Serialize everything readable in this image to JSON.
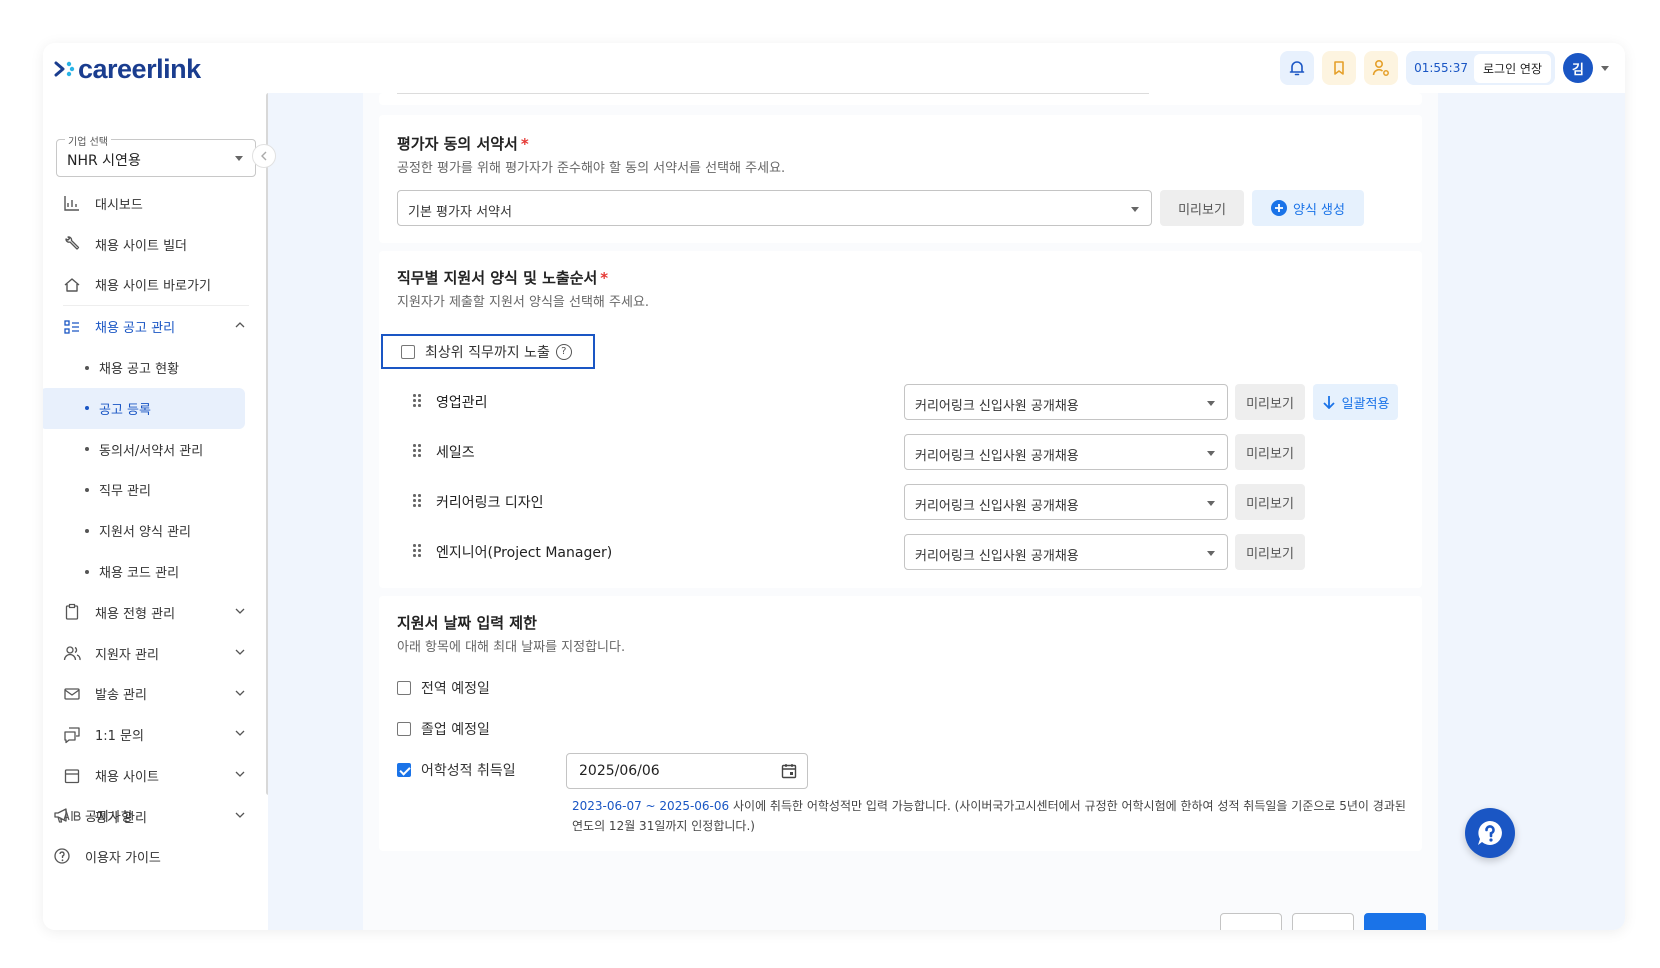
{
  "brand": {
    "logo_text": "careerlink",
    "primary_color": "#1a56c4"
  },
  "header": {
    "session_time": "01:55:37",
    "extend_label": "로그인 연장",
    "avatar_initial": "김"
  },
  "sidebar": {
    "company_label": "기업 선택",
    "company_value": "NHR 시연용",
    "items": [
      {
        "label": "대시보드",
        "icon": "chart-icon"
      },
      {
        "label": "채용 사이트 빌더",
        "icon": "wrench-icon"
      },
      {
        "label": "채용 사이트 바로가기",
        "icon": "home-icon"
      },
      {
        "label": "채용 공고 관리",
        "icon": "list-icon"
      },
      {
        "label": "채용 전형 관리",
        "icon": "clipboard-icon"
      },
      {
        "label": "지원자 관리",
        "icon": "users-icon"
      },
      {
        "label": "발송 관리",
        "icon": "mail-icon"
      },
      {
        "label": "1:1 문의",
        "icon": "chat-icon"
      },
      {
        "label": "채용 사이트",
        "icon": "calendar-icon"
      },
      {
        "label": "평가 관리",
        "icon": "ab-icon"
      }
    ],
    "sub_items": [
      "채용 공고 현황",
      "공고 등록",
      "동의서/서약서 관리",
      "직무 관리",
      "지원서 양식 관리",
      "채용 코드 관리"
    ],
    "bottom": [
      {
        "label": "공지사항",
        "icon": "megaphone-icon"
      },
      {
        "label": "이용자 가이드",
        "icon": "help-icon"
      }
    ]
  },
  "pledge": {
    "title": "평가자 동의 서약서",
    "required_mark": "*",
    "desc": "공정한 평가를 위해 평가자가 준수해야 할 동의 서약서를 선택해 주세요.",
    "select_value": "기본 평가자 서약서",
    "preview_label": "미리보기",
    "create_label": "양식 생성"
  },
  "forms": {
    "title": "직무별 지원서 양식 및 노출순서",
    "required_mark": "*",
    "desc": "지원자가 제출할 지원서 양식을 선택해 주세요.",
    "top_check_label": "최상위 직무까지 노출",
    "apply_all_label": "일괄적용",
    "preview_label": "미리보기",
    "jobs": [
      {
        "name": "영업관리",
        "form": "커리어링크 신입사원 공개채용"
      },
      {
        "name": "세일즈",
        "form": "커리어링크 신입사원 공개채용"
      },
      {
        "name": "커리어링크 디자인",
        "form": "커리어링크 신입사원 공개채용"
      },
      {
        "name": "엔지니어(Project Manager)",
        "form": "커리어링크 신입사원 공개채용"
      }
    ]
  },
  "dates": {
    "title": "지원서 날짜 입력 제한",
    "desc": "아래 항목에 대해 최대 날짜를 지정합니다.",
    "options": [
      {
        "label": "전역 예정일",
        "checked": false
      },
      {
        "label": "졸업 예정일",
        "checked": false
      },
      {
        "label": "어학성적 취득일",
        "checked": true
      }
    ],
    "language_date": "2025/06/06",
    "note_range": "2023-06-07 ~ 2025-06-06",
    "note_text": " 사이에 취득한 어학성적만 입력 가능합니다. (사이버국가고시센터에서 규정한 어학시험에 한하여 성적 취득일을 기준으로 5년이 경과된 연도의 12월 31일까지 인정합니다.)"
  }
}
